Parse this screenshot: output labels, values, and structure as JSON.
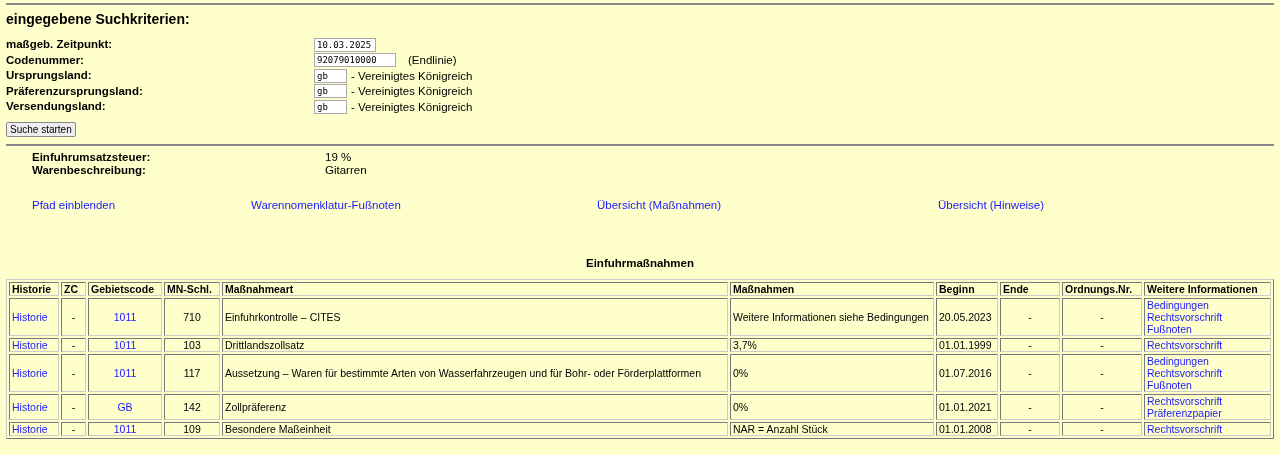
{
  "heading": "eingegebene Suchkriterien:",
  "criteria": [
    {
      "label": "maßgeb. Zeitpunkt:",
      "kind": "date",
      "value": "10.03.2025"
    },
    {
      "label": "Codenummer:",
      "kind": "code",
      "value": "92079010000",
      "suffix": "(Endlinie)"
    },
    {
      "label": "Ursprungsland:",
      "kind": "country",
      "value": "gb",
      "suffix": "- Vereinigtes Königreich"
    },
    {
      "label": "Präferenzursprungsland:",
      "kind": "country",
      "value": "gb",
      "suffix": "- Vereinigtes Königreich"
    },
    {
      "label": "Versendungsland:",
      "kind": "country",
      "value": "gb",
      "suffix": "- Vereinigtes Königreich"
    }
  ],
  "search_button": "Suche starten",
  "info": [
    {
      "label": "Einfuhrumsatzsteuer:",
      "value": "19 %"
    },
    {
      "label": "Warenbeschreibung:",
      "value": "Gitarren"
    }
  ],
  "links": [
    "Pfad einblenden",
    "Warennomenklatur-Fußnoten",
    "Übersicht (Maßnahmen)",
    "Übersicht (Hinweise)"
  ],
  "table": {
    "title": "Einfuhrmaßnahmen",
    "columns": [
      "Historie",
      "ZC",
      "Gebietscode",
      "MN-Schl.",
      "Maßnahmeart",
      "Maßnahmen",
      "Beginn",
      "Ende",
      "Ordnungs.Nr.",
      "Weitere Informationen"
    ],
    "rows": [
      {
        "history": "Historie",
        "zc": "-",
        "area": "1011",
        "mn": "710",
        "type": "Einfuhrkontrolle – CITES",
        "measure": "Weitere Informationen siehe Bedingungen",
        "begin": "20.05.2023",
        "end": "-",
        "order": "-",
        "info": [
          "Bedingungen",
          "Rechtsvorschrift",
          "Fußnoten"
        ]
      },
      {
        "history": "Historie",
        "zc": "-",
        "area": "1011",
        "mn": "103",
        "type": "Drittlandszollsatz",
        "measure": "3,7%",
        "begin": "01.01.1999",
        "end": "-",
        "order": "-",
        "info": [
          "Rechtsvorschrift"
        ]
      },
      {
        "history": "Historie",
        "zc": "-",
        "area": "1011",
        "mn": "117",
        "type": "Aussetzung – Waren für bestimmte Arten von Wasserfahrzeugen und für Bohr- oder Förderplattformen",
        "measure": "0%",
        "begin": "01.07.2016",
        "end": "-",
        "order": "-",
        "info": [
          "Bedingungen",
          "Rechtsvorschrift",
          "Fußnoten"
        ]
      },
      {
        "history": "Historie",
        "zc": "-",
        "area": "GB",
        "mn": "142",
        "type": "Zollpräferenz",
        "measure": "0%",
        "begin": "01.01.2021",
        "end": "-",
        "order": "-",
        "info": [
          "Rechtsvorschrift",
          "Präferenzpapier"
        ]
      },
      {
        "history": "Historie",
        "zc": "-",
        "area": "1011",
        "mn": "109",
        "type": "Besondere Maßeinheit",
        "measure": "NAR = Anzahl Stück",
        "begin": "01.01.2008",
        "end": "-",
        "order": "-",
        "info": [
          "Rechtsvorschrift"
        ]
      }
    ]
  }
}
